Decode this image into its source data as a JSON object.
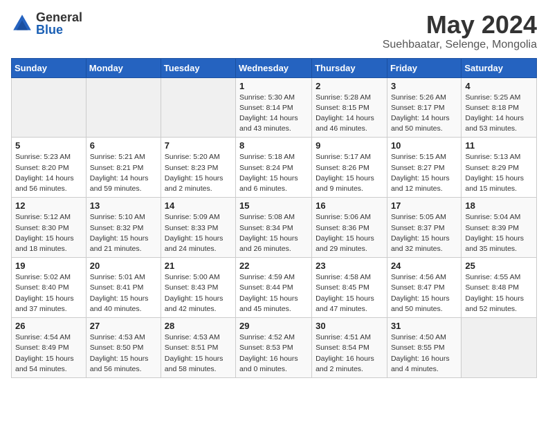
{
  "logo": {
    "general": "General",
    "blue": "Blue"
  },
  "title": "May 2024",
  "location": "Suehbaatar, Selenge, Mongolia",
  "headers": [
    "Sunday",
    "Monday",
    "Tuesday",
    "Wednesday",
    "Thursday",
    "Friday",
    "Saturday"
  ],
  "weeks": [
    [
      {
        "day": "",
        "info": ""
      },
      {
        "day": "",
        "info": ""
      },
      {
        "day": "",
        "info": ""
      },
      {
        "day": "1",
        "info": "Sunrise: 5:30 AM\nSunset: 8:14 PM\nDaylight: 14 hours\nand 43 minutes."
      },
      {
        "day": "2",
        "info": "Sunrise: 5:28 AM\nSunset: 8:15 PM\nDaylight: 14 hours\nand 46 minutes."
      },
      {
        "day": "3",
        "info": "Sunrise: 5:26 AM\nSunset: 8:17 PM\nDaylight: 14 hours\nand 50 minutes."
      },
      {
        "day": "4",
        "info": "Sunrise: 5:25 AM\nSunset: 8:18 PM\nDaylight: 14 hours\nand 53 minutes."
      }
    ],
    [
      {
        "day": "5",
        "info": "Sunrise: 5:23 AM\nSunset: 8:20 PM\nDaylight: 14 hours\nand 56 minutes."
      },
      {
        "day": "6",
        "info": "Sunrise: 5:21 AM\nSunset: 8:21 PM\nDaylight: 14 hours\nand 59 minutes."
      },
      {
        "day": "7",
        "info": "Sunrise: 5:20 AM\nSunset: 8:23 PM\nDaylight: 15 hours\nand 2 minutes."
      },
      {
        "day": "8",
        "info": "Sunrise: 5:18 AM\nSunset: 8:24 PM\nDaylight: 15 hours\nand 6 minutes."
      },
      {
        "day": "9",
        "info": "Sunrise: 5:17 AM\nSunset: 8:26 PM\nDaylight: 15 hours\nand 9 minutes."
      },
      {
        "day": "10",
        "info": "Sunrise: 5:15 AM\nSunset: 8:27 PM\nDaylight: 15 hours\nand 12 minutes."
      },
      {
        "day": "11",
        "info": "Sunrise: 5:13 AM\nSunset: 8:29 PM\nDaylight: 15 hours\nand 15 minutes."
      }
    ],
    [
      {
        "day": "12",
        "info": "Sunrise: 5:12 AM\nSunset: 8:30 PM\nDaylight: 15 hours\nand 18 minutes."
      },
      {
        "day": "13",
        "info": "Sunrise: 5:10 AM\nSunset: 8:32 PM\nDaylight: 15 hours\nand 21 minutes."
      },
      {
        "day": "14",
        "info": "Sunrise: 5:09 AM\nSunset: 8:33 PM\nDaylight: 15 hours\nand 24 minutes."
      },
      {
        "day": "15",
        "info": "Sunrise: 5:08 AM\nSunset: 8:34 PM\nDaylight: 15 hours\nand 26 minutes."
      },
      {
        "day": "16",
        "info": "Sunrise: 5:06 AM\nSunset: 8:36 PM\nDaylight: 15 hours\nand 29 minutes."
      },
      {
        "day": "17",
        "info": "Sunrise: 5:05 AM\nSunset: 8:37 PM\nDaylight: 15 hours\nand 32 minutes."
      },
      {
        "day": "18",
        "info": "Sunrise: 5:04 AM\nSunset: 8:39 PM\nDaylight: 15 hours\nand 35 minutes."
      }
    ],
    [
      {
        "day": "19",
        "info": "Sunrise: 5:02 AM\nSunset: 8:40 PM\nDaylight: 15 hours\nand 37 minutes."
      },
      {
        "day": "20",
        "info": "Sunrise: 5:01 AM\nSunset: 8:41 PM\nDaylight: 15 hours\nand 40 minutes."
      },
      {
        "day": "21",
        "info": "Sunrise: 5:00 AM\nSunset: 8:43 PM\nDaylight: 15 hours\nand 42 minutes."
      },
      {
        "day": "22",
        "info": "Sunrise: 4:59 AM\nSunset: 8:44 PM\nDaylight: 15 hours\nand 45 minutes."
      },
      {
        "day": "23",
        "info": "Sunrise: 4:58 AM\nSunset: 8:45 PM\nDaylight: 15 hours\nand 47 minutes."
      },
      {
        "day": "24",
        "info": "Sunrise: 4:56 AM\nSunset: 8:47 PM\nDaylight: 15 hours\nand 50 minutes."
      },
      {
        "day": "25",
        "info": "Sunrise: 4:55 AM\nSunset: 8:48 PM\nDaylight: 15 hours\nand 52 minutes."
      }
    ],
    [
      {
        "day": "26",
        "info": "Sunrise: 4:54 AM\nSunset: 8:49 PM\nDaylight: 15 hours\nand 54 minutes."
      },
      {
        "day": "27",
        "info": "Sunrise: 4:53 AM\nSunset: 8:50 PM\nDaylight: 15 hours\nand 56 minutes."
      },
      {
        "day": "28",
        "info": "Sunrise: 4:53 AM\nSunset: 8:51 PM\nDaylight: 15 hours\nand 58 minutes."
      },
      {
        "day": "29",
        "info": "Sunrise: 4:52 AM\nSunset: 8:53 PM\nDaylight: 16 hours\nand 0 minutes."
      },
      {
        "day": "30",
        "info": "Sunrise: 4:51 AM\nSunset: 8:54 PM\nDaylight: 16 hours\nand 2 minutes."
      },
      {
        "day": "31",
        "info": "Sunrise: 4:50 AM\nSunset: 8:55 PM\nDaylight: 16 hours\nand 4 minutes."
      },
      {
        "day": "",
        "info": ""
      }
    ]
  ]
}
